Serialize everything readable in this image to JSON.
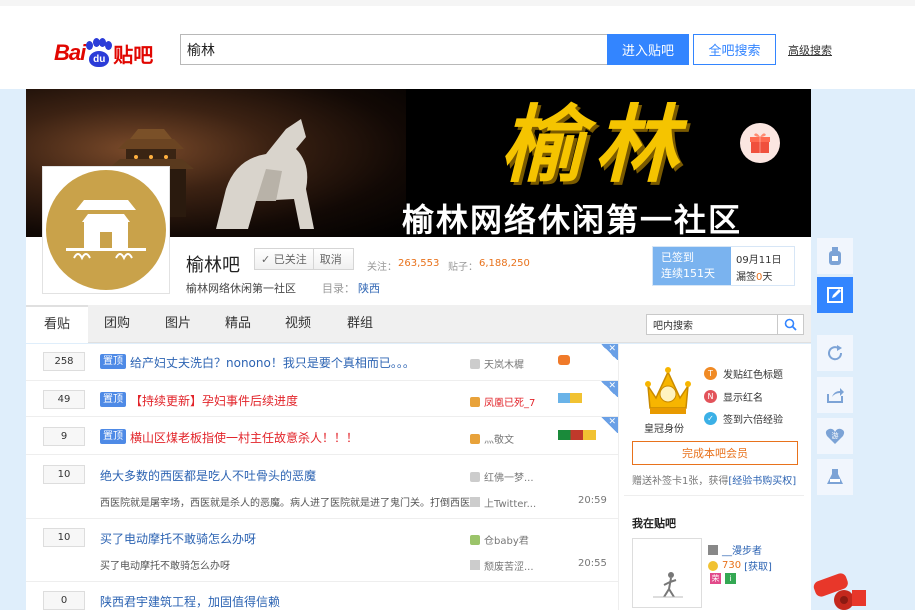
{
  "header": {
    "logo_bai": "Bai",
    "logo_du": "du",
    "logo_tieba": "贴吧",
    "search_value": "榆林",
    "enter_label": "进入贴吧",
    "all_search_label": "全吧搜索",
    "advanced_label": "高级搜索"
  },
  "banner": {
    "title": "榆林",
    "subtitle": "榆林网络休闲第一社区"
  },
  "forum": {
    "name": "榆林吧",
    "followed_label": "✓ 已关注",
    "unfollow_label": "取消",
    "follow_label": "关注：",
    "follow_count": "263,553",
    "post_label": "贴子：",
    "post_count": "6,188,250",
    "slogan": "榆林网络休闲第一社区",
    "dir_label": "目录：",
    "dir_value": "陕西"
  },
  "sign": {
    "status": "已签到",
    "streak": "连续151天",
    "date": "09月11日",
    "missed_prefix": "漏签",
    "missed_count": "0",
    "missed_suffix": "天"
  },
  "tabs": [
    {
      "label": "看贴"
    },
    {
      "label": "团购"
    },
    {
      "label": "图片"
    },
    {
      "label": "精品"
    },
    {
      "label": "视频"
    },
    {
      "label": "群组"
    }
  ],
  "inner_search": {
    "value": "吧内搜索"
  },
  "threads": [
    {
      "replies": "258",
      "badge": "置顶",
      "title": "给产妇丈夫洗白？nonono！我只是要个真相而已。。。",
      "author": "天岚木樨"
    },
    {
      "replies": "49",
      "badge": "置顶",
      "title": "【持续更新】孕妇事件后续进度",
      "author": "凤凰已死_7"
    },
    {
      "replies": "9",
      "badge": "置顶",
      "title": "横山区煤老板指使一村主任故意杀人！！！",
      "author": "灬敬文"
    },
    {
      "replies": "10",
      "title": "绝大多数的西医都是吃人不吐骨头的恶魔",
      "author": "红佛一梦...",
      "abstract": "西医院就是屠宰场，西医就是杀人的恶魔。病人进了医院就是进了鬼门关。打倒西医...",
      "last": "上Twitter...",
      "time": "20:59"
    },
    {
      "replies": "10",
      "title": "买了电动摩托不敢骑怎么办呀",
      "author": "仓baby君",
      "abstract": "买了电动摩托不敢骑怎么办呀",
      "last": "颓废苦涩...",
      "time": "20:55"
    },
    {
      "replies": "0",
      "title": "陕西君宇建筑工程，加固值得信赖"
    }
  ],
  "aside": {
    "crown_label": "皇冠身份",
    "privileges": [
      {
        "label": "发贴红色标题",
        "color": "#f08a24",
        "icon": "title-icon"
      },
      {
        "label": "显示红名",
        "color": "#e2535a",
        "icon": "name-icon"
      },
      {
        "label": "签到六倍经验",
        "color": "#3bb0e6",
        "icon": "sign-icon"
      }
    ],
    "vip_label": "完成本吧会员",
    "makeup_text": "赠送补签卡1张，获得",
    "makeup_link": "[经验书购买权]",
    "in_forum_title": "我在贴吧",
    "user_name": "__漫步者",
    "user_exp": "730",
    "user_exp_link": "[获取]",
    "badge_a": "荣",
    "badge_b": "i"
  },
  "float_tools": [
    "bottle-icon",
    "edit-icon",
    "refresh-icon",
    "share-icon",
    "game-icon",
    "lab-icon"
  ],
  "colors": {
    "accent": "#3385ff",
    "brand_red": "#e10601",
    "link": "#2d64b3",
    "orange": "#e8721c",
    "top_badge": "#4e8ae6"
  }
}
